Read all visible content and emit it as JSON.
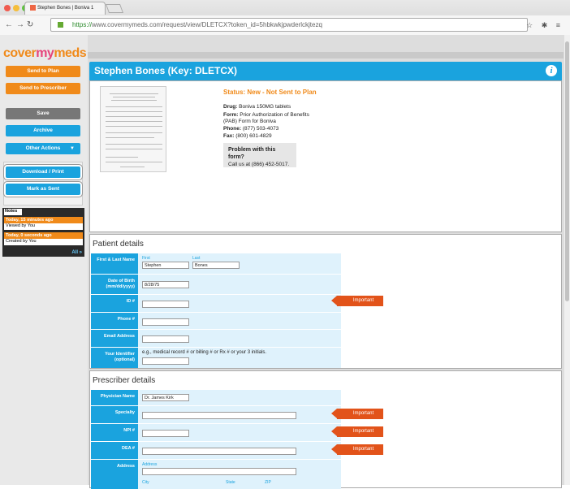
{
  "browser": {
    "tab_title": "Stephen Bones | Boniva 1",
    "url_scheme": "https://",
    "url_rest": "www.covermymeds.com/request/view/DLETCX?token_id=5hbkwkjpwderlckjtezq"
  },
  "sidebar": {
    "logo_cover": "cover",
    "logo_my": "my",
    "logo_meds": "meds",
    "send_to_plan": "Send to Plan",
    "send_to_prescriber": "Send to Prescriber",
    "save": "Save",
    "archive": "Archive",
    "other_actions": "Other Actions",
    "download_print": "Download / Print",
    "mark_as_sent": "Mark as Sent",
    "notes_title": "Notes",
    "notes": [
      {
        "when": "Today, 15 minutes ago",
        "what": "Viewed by You"
      },
      {
        "when": "Today, 0 seconds ago",
        "what": "Created by You"
      }
    ],
    "notes_all": "All »"
  },
  "header": {
    "title": "Stephen Bones (Key: DLETCX)",
    "info_icon": "i"
  },
  "summary": {
    "status": "Status: New - Not Sent to Plan",
    "drug_label": "Drug:",
    "drug_value": "Boniva 150MG tablets",
    "form_label": "Form:",
    "form_value": "Prior Authorization of Benefits (PAB) Form for Boniva",
    "phone_label": "Phone:",
    "phone_value": "(877) 503-4073",
    "fax_label": "Fax:",
    "fax_value": "(800) 601-4829",
    "problem_title": "Problem with this form?",
    "problem_text": "Call us at (866) 452-5017."
  },
  "patient": {
    "heading": "Patient details",
    "name_label": "First & Last Name",
    "first_caption": "First",
    "last_caption": "Last",
    "first_value": "Stephen",
    "last_value": "Bones",
    "dob_label": "Date of Birth (mm/dd/yyyy)",
    "dob_value": "8/28/75",
    "id_label": "ID #",
    "phone_label": "Phone #",
    "email_label": "Email Address",
    "identifier_label": "Your Identifier (optional)",
    "identifier_hint": "e.g., medical record # or billing # or Rx # or your 3 initials.",
    "important": "Important"
  },
  "prescriber": {
    "heading": "Prescriber details",
    "physician_label": "Physician Name",
    "physician_value": "Dr. James Kirk",
    "specialty_label": "Specialty",
    "npi_label": "NPI #",
    "dea_label": "DEA #",
    "address_label": "Address",
    "address_caption": "Address",
    "city_caption": "City",
    "state_caption": "State",
    "zip_caption": "ZIP",
    "important": "Important"
  }
}
